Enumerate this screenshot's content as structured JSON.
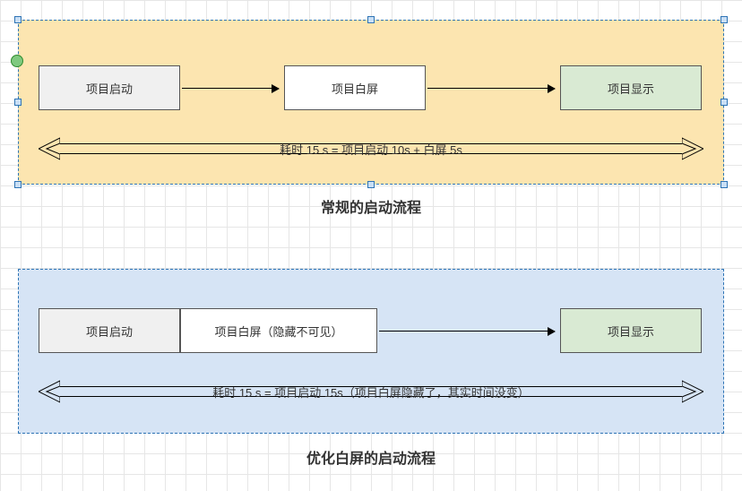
{
  "diagram1": {
    "box_start": "项目启动",
    "box_white": "项目白屏",
    "box_show": "项目显示",
    "span_text": "耗时 15 s = 项目启动 10s + 白屏 5s",
    "caption": "常规的启动流程"
  },
  "diagram2": {
    "box_start": "项目启动",
    "box_white": "项目白屏（隐藏不可见）",
    "box_show": "项目显示",
    "span_text": "耗时 15 s = 项目启动 15s（项目白屏隐藏了，其实时间没变）",
    "caption": "优化白屏的启动流程"
  },
  "colors": {
    "panel1_bg": "#fce5b0",
    "panel2_bg": "#d6e4f5",
    "start_box": "#f0f0f0",
    "show_box": "#d9ead3"
  }
}
